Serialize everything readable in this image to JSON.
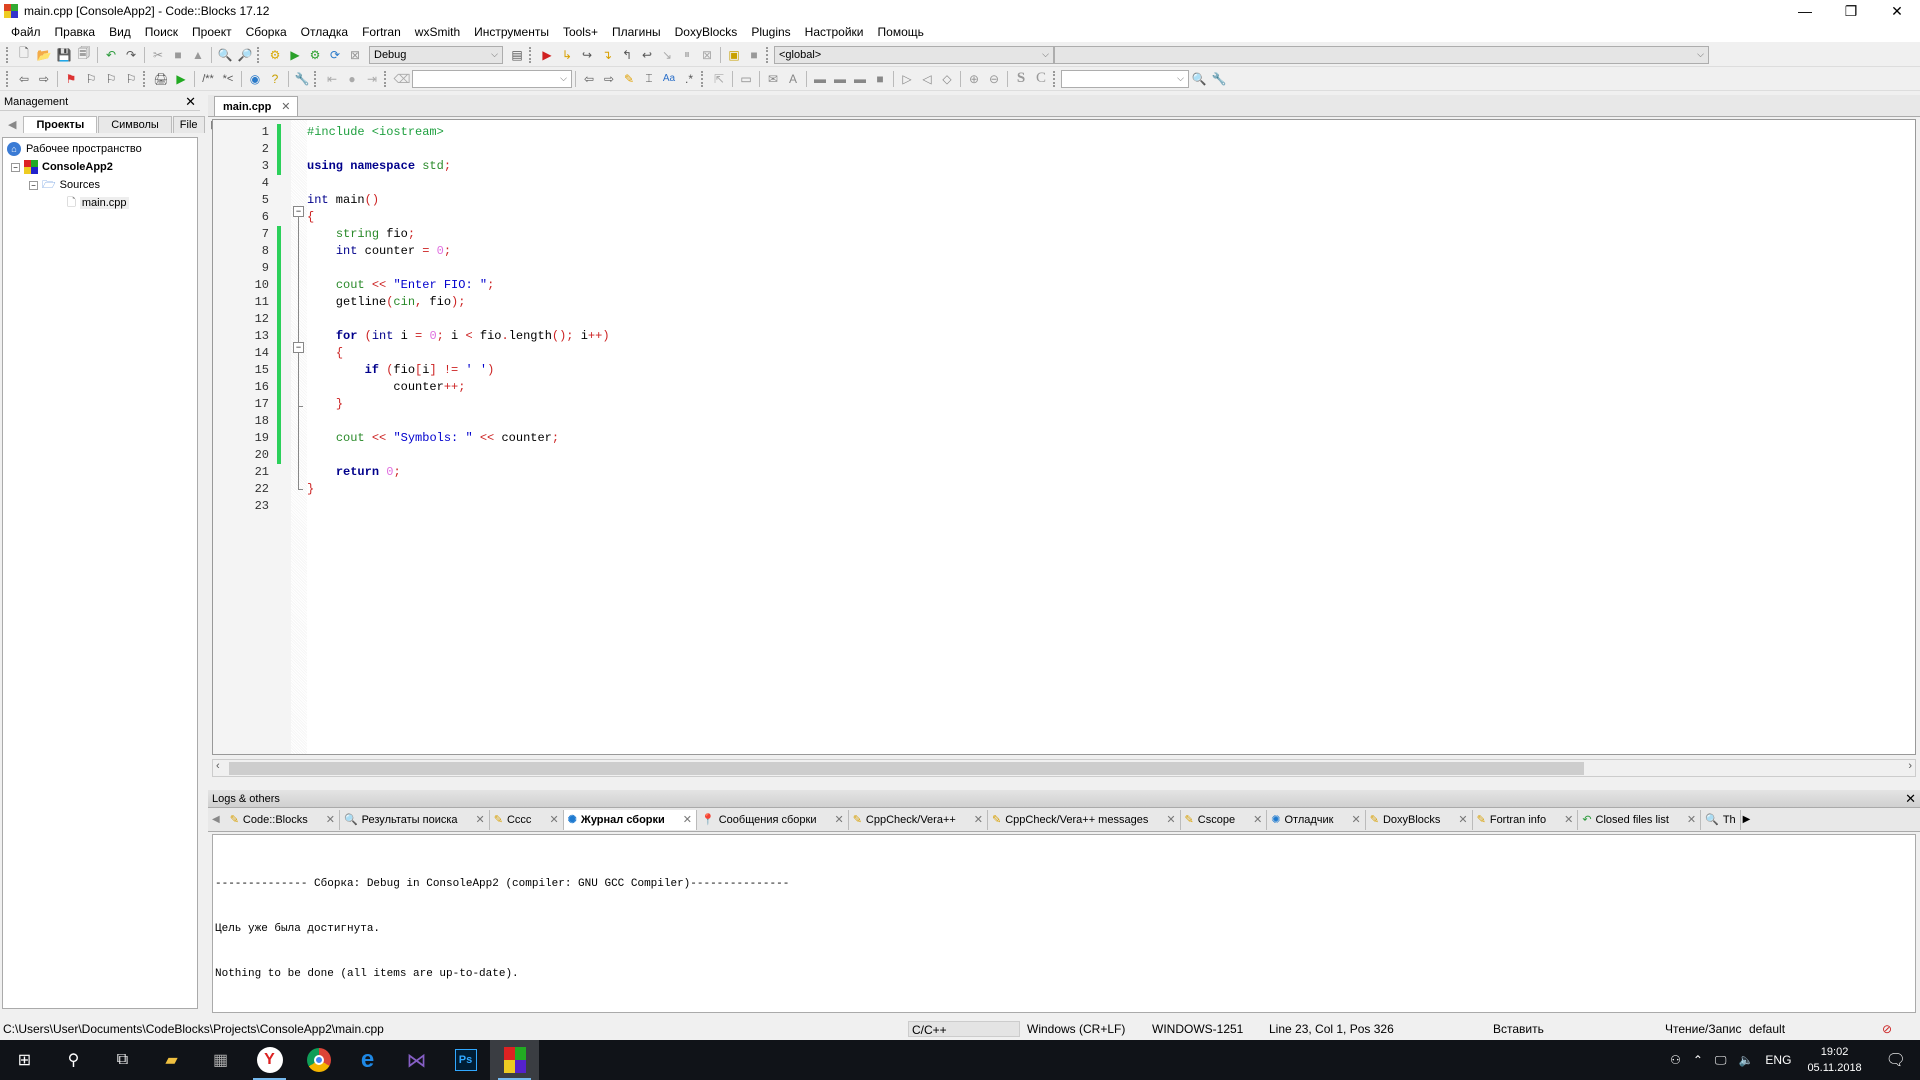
{
  "window": {
    "title": "main.cpp [ConsoleApp2] - Code::Blocks 17.12",
    "controls": {
      "minimize": "—",
      "restore": "❐",
      "close": "✕"
    }
  },
  "menu": [
    "Файл",
    "Правка",
    "Вид",
    "Поиск",
    "Проект",
    "Сборка",
    "Отладка",
    "Fortran",
    "wxSmith",
    "Инструменты",
    "Tools+",
    "Плагины",
    "DoxyBlocks",
    "Plugins",
    "Настройки",
    "Помощь"
  ],
  "toolbar": {
    "build_target": "Debug",
    "scope": "<global>",
    "function_combo": "",
    "search_combo": "",
    "find_combo": ""
  },
  "management": {
    "title": "Management",
    "tabs": [
      "Проекты",
      "Символы",
      "File"
    ],
    "active_tab": "Проекты",
    "tree": [
      {
        "label": "Рабочее пространство",
        "icon": "workspace-icon"
      },
      {
        "label": "ConsoleApp2",
        "icon": "project-icon"
      },
      {
        "label": "Sources",
        "icon": "folder-icon"
      },
      {
        "label": "main.cpp",
        "icon": "file-icon"
      }
    ]
  },
  "editor": {
    "tab": "main.cpp",
    "lines": [
      {
        "n": "1",
        "html": "<span class='pp'>#include &lt;iostream&gt;</span>",
        "changed": true
      },
      {
        "n": "2",
        "html": "",
        "changed": true
      },
      {
        "n": "3",
        "html": "<span class='kw'>using</span> <span class='kw'>namespace</span> <span class='grn'>std</span><span class='op'>;</span>",
        "changed": true
      },
      {
        "n": "4",
        "html": "",
        "changed": false
      },
      {
        "n": "5",
        "html": "<span class='kw2'>int</span> main<span class='op'>()</span>",
        "changed": false
      },
      {
        "n": "6",
        "html": "<span class='op'>{</span>",
        "changed": false
      },
      {
        "n": "7",
        "html": "    <span class='grn'>string</span> fio<span class='op'>;</span>",
        "changed": true
      },
      {
        "n": "8",
        "html": "    <span class='kw2'>int</span> counter <span class='op'>=</span> <span class='num'>0</span><span class='op'>;</span>",
        "changed": true
      },
      {
        "n": "9",
        "html": "",
        "changed": true
      },
      {
        "n": "10",
        "html": "    <span class='grn'>cout</span> <span class='op'>&lt;&lt;</span> <span class='str'>\"Enter FIO: \"</span><span class='op'>;</span>",
        "changed": true
      },
      {
        "n": "11",
        "html": "    getline<span class='op'>(</span><span class='grn'>cin</span><span class='op'>,</span> fio<span class='op'>);</span>",
        "changed": true
      },
      {
        "n": "12",
        "html": "",
        "changed": true
      },
      {
        "n": "13",
        "html": "    <span class='kw'>for</span> <span class='op'>(</span><span class='kw2'>int</span> i <span class='op'>=</span> <span class='num'>0</span><span class='op'>;</span> i <span class='op'>&lt;</span> fio<span class='op'>.</span>length<span class='op'>();</span> i<span class='op'>++)</span>",
        "changed": true
      },
      {
        "n": "14",
        "html": "    <span class='op'>{</span>",
        "changed": true
      },
      {
        "n": "15",
        "html": "        <span class='kw'>if</span> <span class='op'>(</span>fio<span class='op'>[</span>i<span class='op'>]</span> <span class='op'>!=</span> <span class='str'>' '</span><span class='op'>)</span>",
        "changed": true
      },
      {
        "n": "16",
        "html": "            counter<span class='op'>++;</span>",
        "changed": true
      },
      {
        "n": "17",
        "html": "    <span class='op'>}</span>",
        "changed": true
      },
      {
        "n": "18",
        "html": "",
        "changed": true
      },
      {
        "n": "19",
        "html": "    <span class='grn'>cout</span> <span class='op'>&lt;&lt;</span> <span class='str'>\"Symbols: \"</span> <span class='op'>&lt;&lt;</span> counter<span class='op'>;</span>",
        "changed": true
      },
      {
        "n": "20",
        "html": "",
        "changed": true
      },
      {
        "n": "21",
        "html": "    <span class='kw'>return</span> <span class='num'>0</span><span class='op'>;</span>",
        "changed": false
      },
      {
        "n": "22",
        "html": "<span class='op'>}</span>",
        "changed": false
      },
      {
        "n": "23",
        "html": "",
        "changed": false
      }
    ]
  },
  "logs": {
    "title": "Logs & others",
    "tabs": [
      {
        "label": "Code::Blocks",
        "icon": "pencil-icon"
      },
      {
        "label": "Результаты поиска",
        "icon": "search-icon"
      },
      {
        "label": "Cccc",
        "icon": "pencil-icon"
      },
      {
        "label": "Журнал сборки",
        "icon": "gear-icon",
        "active": true
      },
      {
        "label": "Сообщения сборки",
        "icon": "pin-icon"
      },
      {
        "label": "CppCheck/Vera++",
        "icon": "pencil-icon"
      },
      {
        "label": "CppCheck/Vera++ messages",
        "icon": "pencil-icon"
      },
      {
        "label": "Cscope",
        "icon": "pencil-icon"
      },
      {
        "label": "Отладчик",
        "icon": "gear-icon"
      },
      {
        "label": "DoxyBlocks",
        "icon": "pencil-icon"
      },
      {
        "label": "Fortran info",
        "icon": "pencil-icon"
      },
      {
        "label": "Closed files list",
        "icon": "undo-icon"
      },
      {
        "label": "Th",
        "icon": "search-icon"
      }
    ],
    "lines": [
      "-------------- Сборка: Debug in ConsoleApp2 (compiler: GNU GCC Compiler)---------------",
      "Цель уже была достигнута.",
      "Nothing to be done (all items are up-to-date)."
    ]
  },
  "status": {
    "path": "C:\\Users\\User\\Documents\\CodeBlocks\\Projects\\ConsoleApp2\\main.cpp",
    "language": "C/C++",
    "eol": "Windows (CR+LF)",
    "encoding": "WINDOWS-1251",
    "position": "Line 23, Col 1, Pos 326",
    "mode": "Вставить",
    "access": "Чтение/Запис",
    "profile": "default"
  },
  "taskbar": {
    "lang": "ENG",
    "time": "19:02",
    "date": "05.11.2018"
  }
}
